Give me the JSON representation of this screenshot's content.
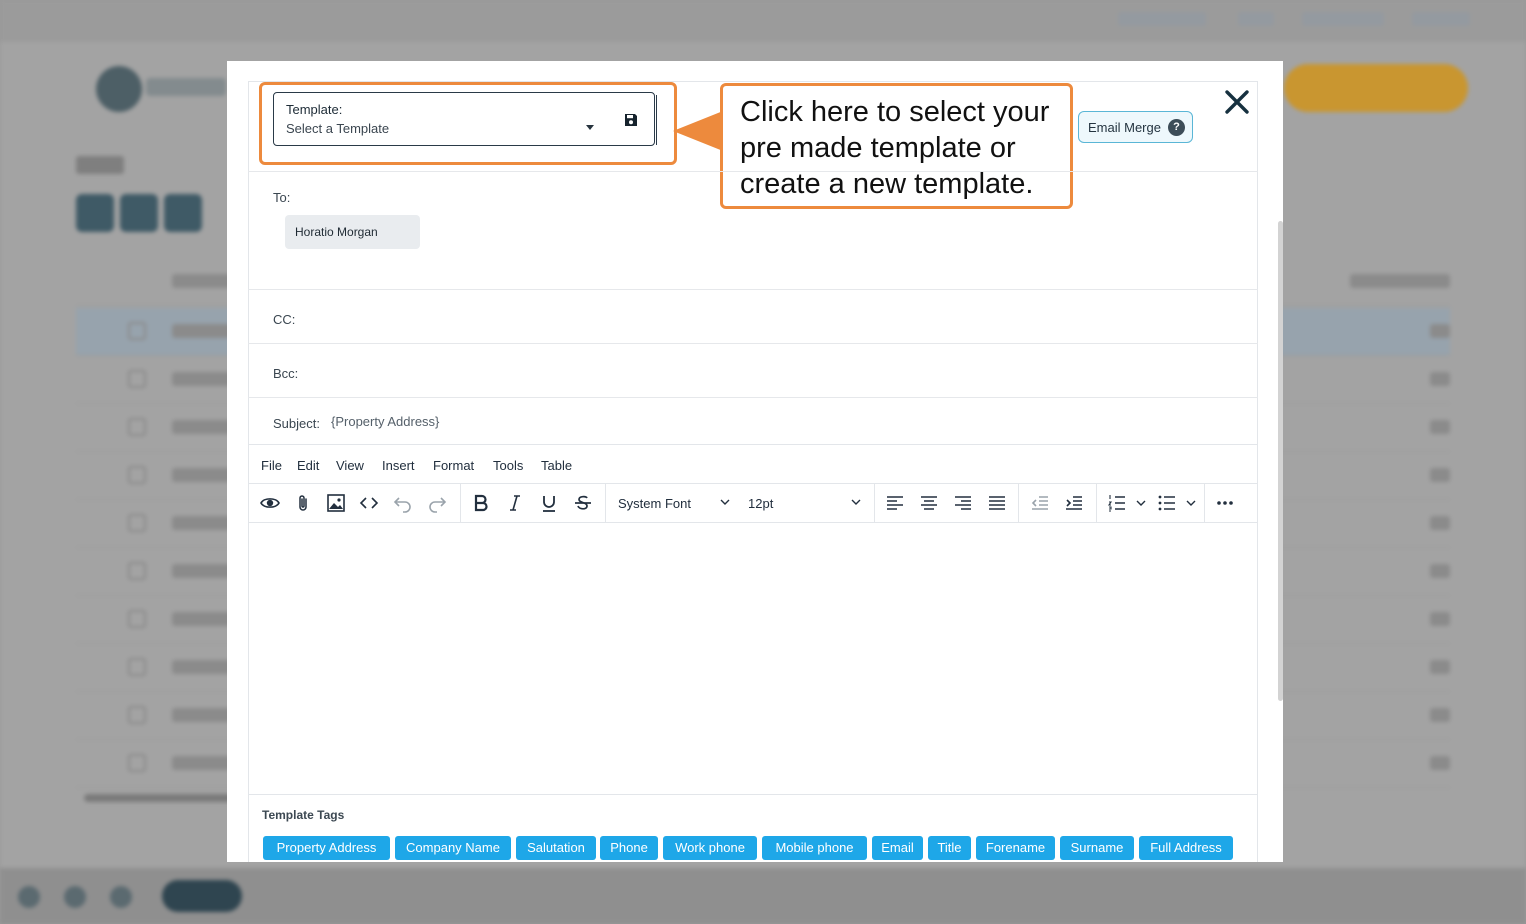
{
  "modal": {
    "template": {
      "label": "Template:",
      "placeholder": "Select a Template"
    },
    "callout": "Click here to select your pre made template or create a new template.",
    "email_merge": {
      "label": "Email Merge",
      "help": "?"
    },
    "to": {
      "label": "To:",
      "recipients": [
        "Horatio Morgan"
      ]
    },
    "cc": {
      "label": "CC:"
    },
    "bcc": {
      "label": "Bcc:"
    },
    "subject": {
      "label": "Subject:",
      "value": "{Property Address}"
    },
    "editor": {
      "menu": [
        "File",
        "Edit",
        "View",
        "Insert",
        "Format",
        "Tools",
        "Table"
      ],
      "font_family": "System Font",
      "font_size": "12pt",
      "toolbar_icons": [
        "preview-icon",
        "attachment-icon",
        "image-icon",
        "code-icon",
        "undo-icon",
        "redo-icon",
        "bold-icon",
        "italic-icon",
        "underline-icon",
        "strikethrough-icon",
        "align-left-icon",
        "align-center-icon",
        "align-right-icon",
        "align-justify-icon",
        "outdent-icon",
        "indent-icon",
        "numbered-list-icon",
        "bullet-list-icon",
        "more-icon"
      ]
    },
    "template_tags": {
      "title": "Template Tags",
      "tags": [
        "Property Address",
        "Company Name",
        "Salutation",
        "Phone",
        "Work phone",
        "Mobile phone",
        "Email",
        "Title",
        "Forename",
        "Surname",
        "Full Address"
      ]
    }
  },
  "colors": {
    "accent_orange": "#ed8a3d",
    "tag_blue": "#1ea7e8",
    "account_button": "#c99630",
    "overlay": "#9a9a9a"
  }
}
